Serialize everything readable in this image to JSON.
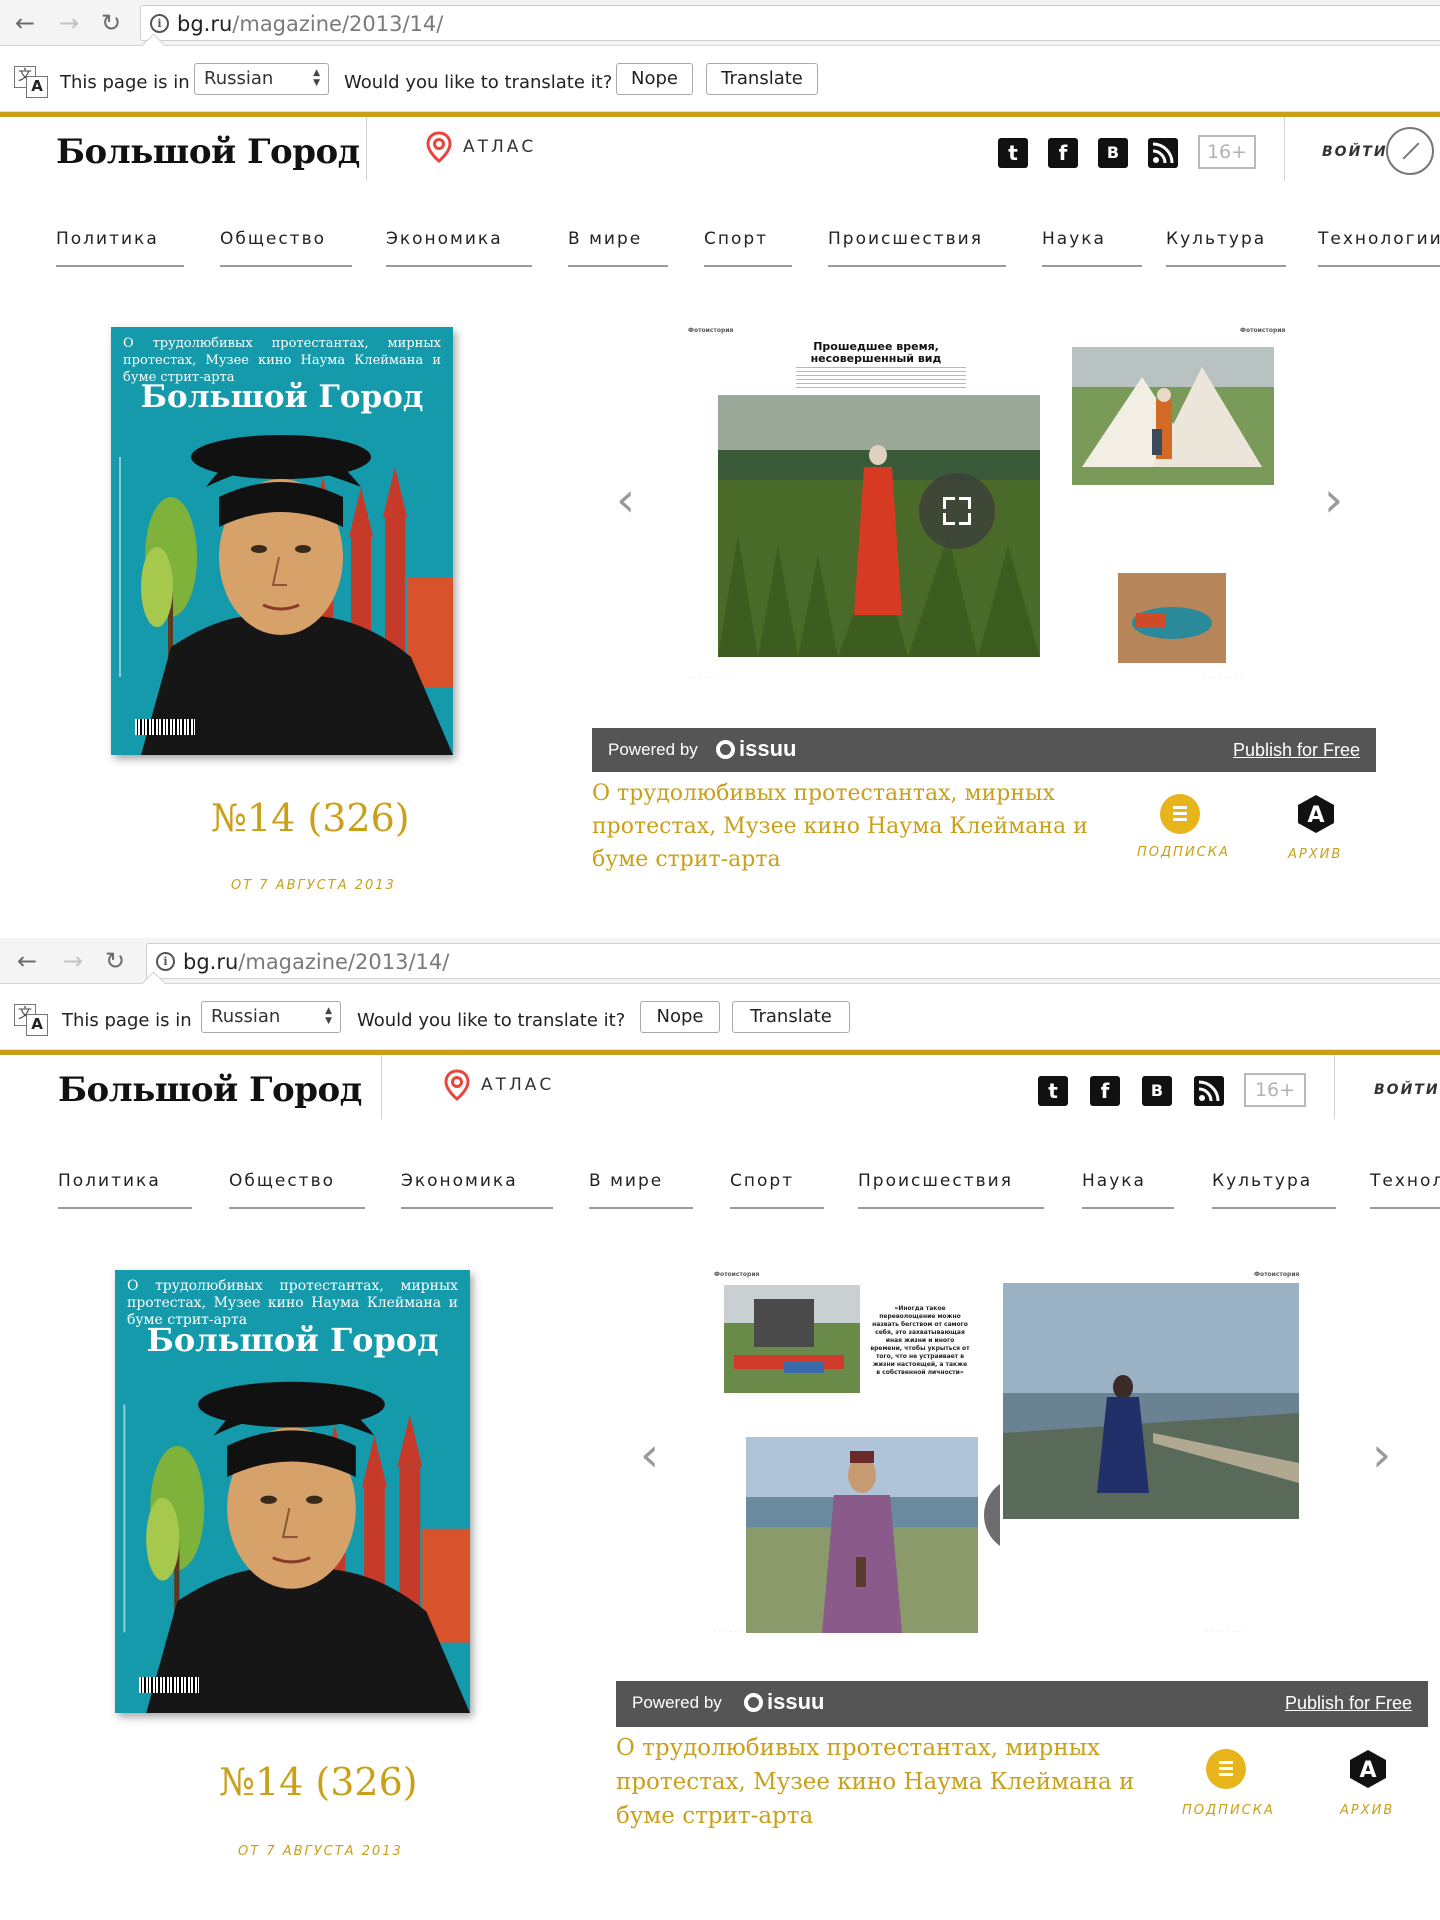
{
  "browser": {
    "url_domain": "bg.ru",
    "url_path": "/magazine/2013/14/",
    "back_icon": "←",
    "forward_icon": "→",
    "reload_icon": "↻",
    "info_icon": "i"
  },
  "translate_bar": {
    "icon_glyph_1": "文",
    "icon_glyph_2": "A",
    "page_is_in": "This page is in",
    "language": "Russian",
    "question": "Would you like to translate it?",
    "nope": "Nope",
    "translate": "Translate"
  },
  "site": {
    "logo": "Большой Город",
    "atlas": "АТЛАС",
    "social": {
      "twitter": "t",
      "facebook": "f",
      "vk": "B"
    },
    "age_rating": "16+",
    "login": "ВОЙТИ",
    "accent_color": "#c9a019"
  },
  "nav": [
    "Политика",
    "Общество",
    "Экономика",
    "В мире",
    "Спорт",
    "Происшествия",
    "Наука",
    "Культура",
    "Технологии"
  ],
  "issue": {
    "cover_tagline": "О трудолюбивых протестантах, мирных протестах, Музее кино Наума Клеймана и буме стрит-арта",
    "cover_title": "Большой Город",
    "number": "№14 (326)",
    "date": "ОТ 7 АВГУСТА 2013",
    "description": "О трудолюбивых протестантах, мирных протестах, Музее кино Наума Клеймана и буме стрит-арта"
  },
  "viewer": {
    "prev_arrow": "‹",
    "next_arrow": "›",
    "powered_by": "Powered by",
    "issuu": "issuu",
    "publish": "Publish for Free",
    "section_label": "Фотоистория",
    "spread1_title": "Прошедшее время, несовершенный вид",
    "spread2_quote": "«Иногда такое переволощение можно назвать бегством от самого себя, это захватывающая иная жизни и иного времени, чтобы укрыться от того, что не устраивает в жизни настоящей, а также в собственной личности»"
  },
  "actions": {
    "subscribe": "ПОДПИСКА",
    "archive": "АРХИВ",
    "archive_glyph": "A"
  }
}
